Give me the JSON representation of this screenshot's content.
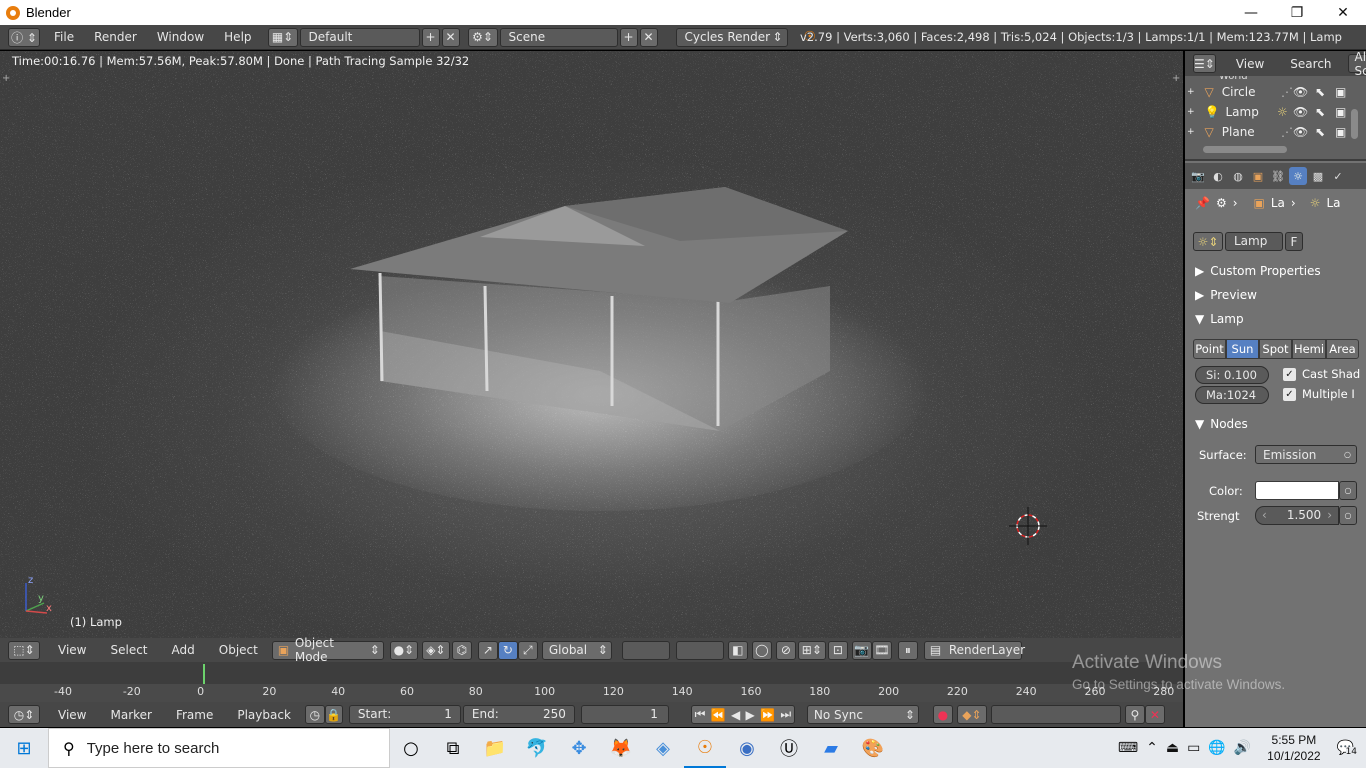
{
  "window": {
    "title": "Blender",
    "controls": {
      "minimize": "—",
      "maximize": "❐",
      "close": "✕"
    }
  },
  "header": {
    "menus": [
      "File",
      "Render",
      "Window",
      "Help"
    ],
    "layout": "Default",
    "scene": "Scene",
    "engine": "Cycles Render",
    "stats": "v2.79 | Verts:3,060 | Faces:2,498 | Tris:5,024 | Objects:1/3 | Lamps:1/1 | Mem:123.77M | Lamp"
  },
  "viewport": {
    "info": "Time:00:16.76 | Mem:57.56M, Peak:57.80M | Done | Path Tracing Sample 32/32",
    "selected": "(1) Lamp",
    "axes": {
      "z": "z",
      "y": "y",
      "x": "x"
    }
  },
  "viewport_header": {
    "menus": [
      "View",
      "Select",
      "Add",
      "Object"
    ],
    "mode": "Object Mode",
    "orientation": "Global",
    "render_layer": "RenderLayer"
  },
  "timeline": {
    "ticks": [
      "-40",
      "-20",
      "0",
      "20",
      "40",
      "60",
      "80",
      "100",
      "120",
      "140",
      "160",
      "180",
      "200",
      "220",
      "240",
      "260",
      "280"
    ],
    "menus": [
      "View",
      "Marker",
      "Frame",
      "Playback"
    ],
    "start_label": "Start:",
    "start": "1",
    "end_label": "End:",
    "end": "250",
    "current": "1",
    "sync": "No Sync"
  },
  "outliner": {
    "menus": [
      "View",
      "Search"
    ],
    "filter": "All Sc",
    "partial_top": "World",
    "items": [
      "Circle",
      "Lamp",
      "Plane"
    ]
  },
  "properties": {
    "breadcrumb": [
      "La",
      "La"
    ],
    "datablock": "Lamp",
    "fake": "F",
    "panels": {
      "custom": "Custom Properties",
      "preview": "Preview",
      "lamp": "Lamp",
      "nodes": "Nodes"
    },
    "lamp_types": [
      "Point",
      "Sun",
      "Spot",
      "Hemi",
      "Area"
    ],
    "lamp_type_selected": "Sun",
    "size": "Si: 0.100",
    "max_bounces": "Ma:1024",
    "cast_shadow": "Cast Shad",
    "multiple": "Multiple I",
    "surface_label": "Surface:",
    "surface": "Emission",
    "color_label": "Color:",
    "strength_label": "Strengt",
    "strength": "1.500"
  },
  "watermark": {
    "line1": "Activate Windows",
    "line2": "Go to Settings to activate Windows."
  },
  "taskbar": {
    "search_placeholder": "Type here to search",
    "time": "5:55 PM",
    "date": "10/1/2022",
    "notifications": "14"
  },
  "colors": {
    "accent": "#5680c2",
    "blender_orange": "#e87d0d",
    "header": "#474747",
    "panel": "#727272"
  }
}
